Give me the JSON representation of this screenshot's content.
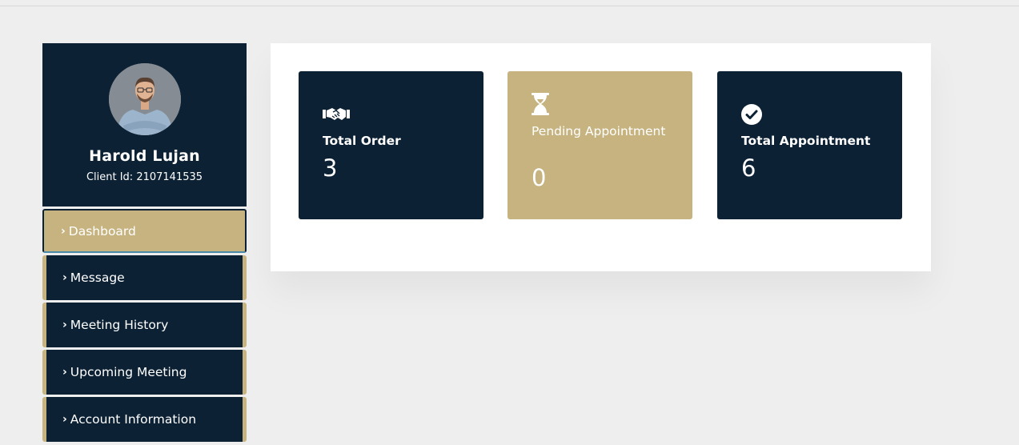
{
  "profile": {
    "name": "Harold Lujan",
    "client_id": "Client Id: 2107141535"
  },
  "nav": {
    "items": [
      {
        "label": "Dashboard",
        "active": true
      },
      {
        "label": "Message",
        "active": false
      },
      {
        "label": "Meeting History",
        "active": false
      },
      {
        "label": "Upcoming Meeting",
        "active": false
      },
      {
        "label": "Account Information",
        "active": false
      }
    ]
  },
  "stats": [
    {
      "label": "Total Order",
      "value": "3",
      "icon": "handshake-icon",
      "color": "#0c2134"
    },
    {
      "label": "Pending Appointment",
      "value": "0",
      "icon": "hourglass-icon",
      "color": "#c6b37f"
    },
    {
      "label": "Total Appointment",
      "value": "6",
      "icon": "check-circle-icon",
      "color": "#0c2134"
    }
  ],
  "colors": {
    "navy": "#0c2134",
    "gold": "#c6b37f",
    "background": "#eeeeee"
  }
}
